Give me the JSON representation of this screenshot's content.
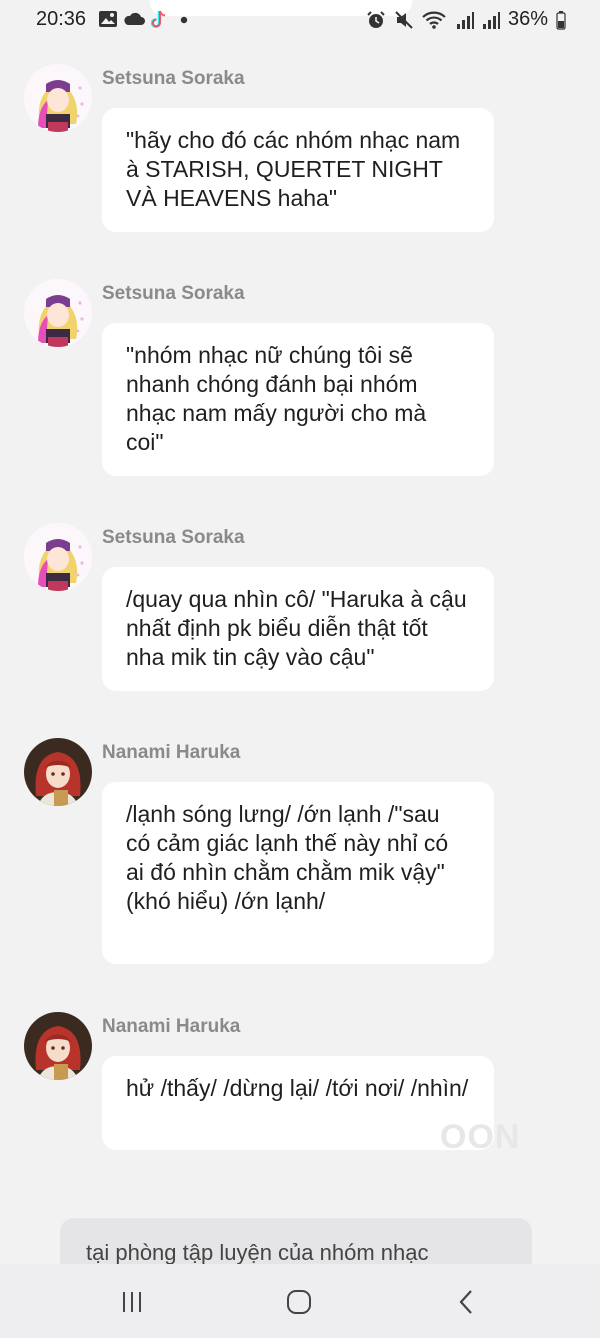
{
  "status_bar": {
    "time": "20:36",
    "battery": "36%",
    "left_icons": [
      "image-icon",
      "cloud-icon",
      "tiktok-icon",
      "dot-icon"
    ],
    "right_icons": [
      "alarm-icon",
      "mute-icon",
      "wifi-icon",
      "signal-icon",
      "signal-icon",
      "battery-icon"
    ]
  },
  "messages": [
    {
      "sender": "Setsuna Soraka",
      "avatar": "blonde-character-avatar",
      "text": "\"hãy cho đó các nhóm nhạc nam à STARISH, QUERTET NIGHT VÀ HEAVENS haha\""
    },
    {
      "sender": "Setsuna Soraka",
      "avatar": "blonde-character-avatar",
      "text": "\"nhóm nhạc nữ chúng tôi sẽ nhanh chóng đánh bại nhóm nhạc nam mấy người cho mà coi\""
    },
    {
      "sender": "Setsuna Soraka",
      "avatar": "blonde-character-avatar",
      "text": "/quay qua nhìn cô/ \"Haruka à cậu nhất định pk biểu diễn thật tốt nha mik tin cậy vào cậu\""
    },
    {
      "sender": "Nanami Haruka",
      "avatar": "redhead-character-avatar",
      "text": "/lạnh sóng lưng/ /ớn lạnh /\"sau có cảm giác lạnh thế này nhỉ có ai đó nhìn chằm chằm mik vậy\" (khó hiểu) /ớn lạnh/"
    },
    {
      "sender": "Nanami Haruka",
      "avatar": "redhead-character-avatar",
      "text": "hử /thấy/ /dừng lại/ /tới nơi/ /nhìn/"
    }
  ],
  "narration": "tại phòng tập luyện của nhóm nhạc",
  "watermark": "OON",
  "nav_bar": {
    "buttons": [
      "recent-apps-icon",
      "home-icon",
      "back-icon"
    ]
  }
}
